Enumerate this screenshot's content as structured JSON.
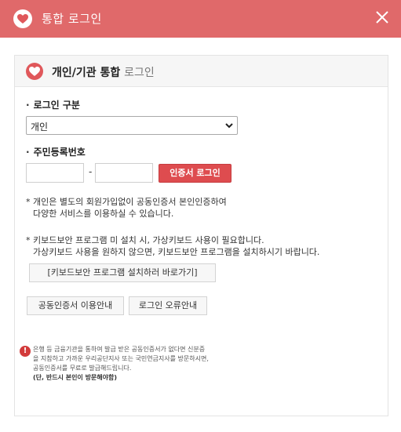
{
  "titlebar": {
    "title": "통합 로그인",
    "logo_icon": "heart-chat-icon",
    "close_icon": "close-icon"
  },
  "panel": {
    "title": "개인/기관 통합",
    "subtitle": "로그인",
    "login_type_label": "로그인 구분",
    "login_type_value": "개인",
    "id_label": "주민등록번호",
    "dash": "-",
    "cert_button": "인증서 로그인",
    "note1_line1": "* 개인은 별도의 회원가입없이 공동인증서 본인인증하여",
    "note1_line2": "다양한 서비스를 이용하실 수 있습니다.",
    "note2_line1": "* 키보드보안 프로그램 미 설치 시, 가상키보드 사용이 필요합니다.",
    "note2_line2": "가상키보드 사용을 원하지 않으면, 키보드보안 프로그램을 설치하시기 바랍니다.",
    "install_button": "[키보드보안 프로그램 설치하러 바로가기]",
    "cert_guide_button": "공동인증서 이용안내",
    "login_error_button": "로그인 오류안내",
    "warning_line1": "은행 등 금융기관을 통하여 발급 받은 공동인증서가 없다면 신분증",
    "warning_line2": "을 지참하고 가까운 우리공단지사 또는 국민연금지사를 방문하시면,",
    "warning_line3": "공동인증서를 무료로 발급해드립니다.",
    "warning_line4": "(단, 반드시 본인이 방문해야함)"
  },
  "colors": {
    "titlebar": "#e0696a",
    "accent": "#de4c4f"
  }
}
